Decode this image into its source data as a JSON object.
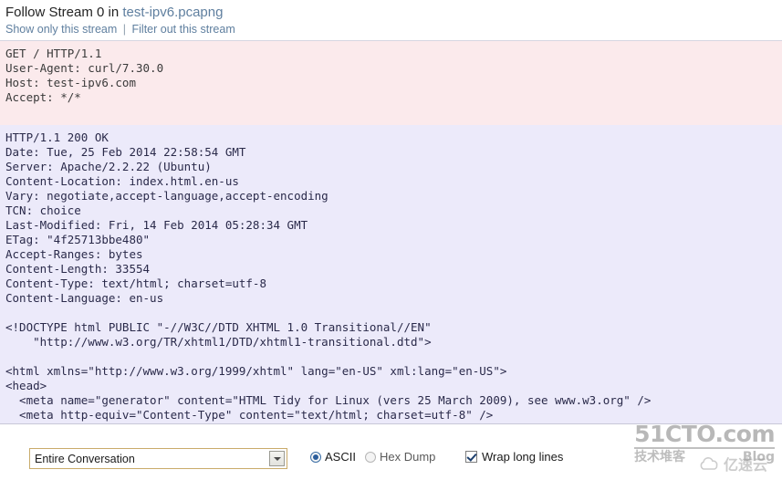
{
  "header": {
    "title_prefix": "Follow Stream 0 in",
    "filename": "test-ipv6.pcapng",
    "link_show_only": "Show only this stream",
    "link_separator": "|",
    "link_filter_out": "Filter out this stream"
  },
  "stream": {
    "request": {
      "direction": "client-to-server",
      "background_color": "#fbeaec",
      "lines": [
        "GET / HTTP/1.1",
        "User-Agent: curl/7.30.0",
        "Host: test-ipv6.com",
        "Accept: */*",
        ""
      ]
    },
    "response": {
      "direction": "server-to-client",
      "background_color": "#eceafa",
      "lines": [
        "HTTP/1.1 200 OK",
        "Date: Tue, 25 Feb 2014 22:58:54 GMT",
        "Server: Apache/2.2.22 (Ubuntu)",
        "Content-Location: index.html.en-us",
        "Vary: negotiate,accept-language,accept-encoding",
        "TCN: choice",
        "Last-Modified: Fri, 14 Feb 2014 05:28:34 GMT",
        "ETag: \"4f25713bbe480\"",
        "Accept-Ranges: bytes",
        "Content-Length: 33554",
        "Content-Type: text/html; charset=utf-8",
        "Content-Language: en-us",
        "",
        "<!DOCTYPE html PUBLIC \"-//W3C//DTD XHTML 1.0 Transitional//EN\"",
        "    \"http://www.w3.org/TR/xhtml1/DTD/xhtml1-transitional.dtd\">",
        "",
        "<html xmlns=\"http://www.w3.org/1999/xhtml\" lang=\"en-US\" xml:lang=\"en-US\">",
        "<head>",
        "  <meta name=\"generator\" content=\"HTML Tidy for Linux (vers 25 March 2009), see www.w3.org\" />",
        "  <meta http-equiv=\"Content-Type\" content=\"text/html; charset=utf-8\" />"
      ]
    }
  },
  "controls": {
    "stream_filter": {
      "selected": "Entire Conversation",
      "options": [
        "Entire Conversation"
      ]
    },
    "format": {
      "selected": "ASCII",
      "options": [
        {
          "label": "ASCII",
          "checked": true
        },
        {
          "label": "Hex Dump",
          "checked": false
        }
      ]
    },
    "wrap": {
      "label": "Wrap long lines",
      "checked": true
    }
  },
  "watermarks": {
    "cto_main": "51CTO.com",
    "cto_sub_left": "技术堆客",
    "cto_sub_right": "Blog",
    "yisuyun": "亿速云"
  }
}
